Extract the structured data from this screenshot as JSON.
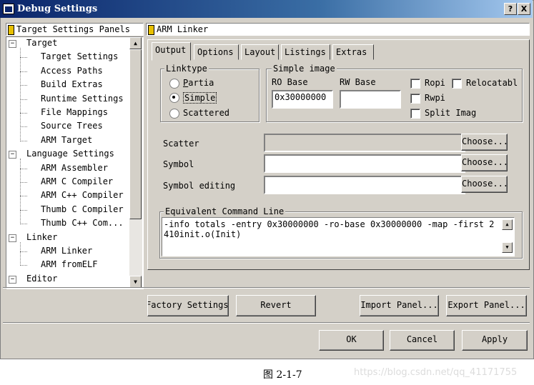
{
  "window": {
    "title": "Debug Settings",
    "help_button": "?",
    "close_button": "X"
  },
  "tree_panel": {
    "header": "Target Settings Panels",
    "items": [
      {
        "label": "Target",
        "expander": "−"
      },
      {
        "label": "Target Settings"
      },
      {
        "label": "Access Paths"
      },
      {
        "label": "Build Extras"
      },
      {
        "label": "Runtime Settings"
      },
      {
        "label": "File Mappings"
      },
      {
        "label": "Source Trees"
      },
      {
        "label": "ARM Target"
      },
      {
        "label": "Language Settings",
        "expander": "−"
      },
      {
        "label": "ARM Assembler"
      },
      {
        "label": "ARM C Compiler"
      },
      {
        "label": "ARM C++ Compiler"
      },
      {
        "label": "Thumb C Compiler"
      },
      {
        "label": "Thumb C++ Com..."
      },
      {
        "label": "Linker",
        "expander": "−"
      },
      {
        "label": "ARM Linker"
      },
      {
        "label": "ARM fromELF"
      },
      {
        "label": "Editor",
        "expander": "−"
      }
    ]
  },
  "panel": {
    "header": "ARM Linker",
    "tabs": [
      "Output",
      "Options",
      "Layout",
      "Listings",
      "Extras"
    ],
    "linktype": {
      "label": "Linktype",
      "options": [
        {
          "label": "Partia",
          "selected": false
        },
        {
          "label": "Simple",
          "selected": true
        },
        {
          "label": "Scattered",
          "selected": false
        }
      ]
    },
    "simple_image": {
      "label": "Simple image",
      "ro_base_label": "RO Base",
      "rw_base_label": "RW Base",
      "ro_base_value": "0x30000000",
      "rw_base_value": "",
      "ropi_label": "Ropi",
      "relocatable_label": "Relocatabl",
      "rwpi_label": "Rwpi",
      "split_image_label": "Split Imag"
    },
    "scatter_label": "Scatter",
    "symbol_label": "Symbol",
    "symbol_editing_label": "Symbol editing",
    "choose_label": "Choose...",
    "equivalent": {
      "label": "Equivalent Command Line",
      "text": "-info totals -entry 0x30000000 -ro-base 0x30000000 -map -first 2410init.o(Init)"
    }
  },
  "buttons": {
    "factory": "Factory Settings",
    "revert": "Revert",
    "import": "Import Panel...",
    "export": "Export Panel...",
    "ok": "OK",
    "cancel": "Cancel",
    "apply": "Apply"
  },
  "caption": "图 2-1-7",
  "watermark": "https://blog.csdn.net/qq_41171755"
}
